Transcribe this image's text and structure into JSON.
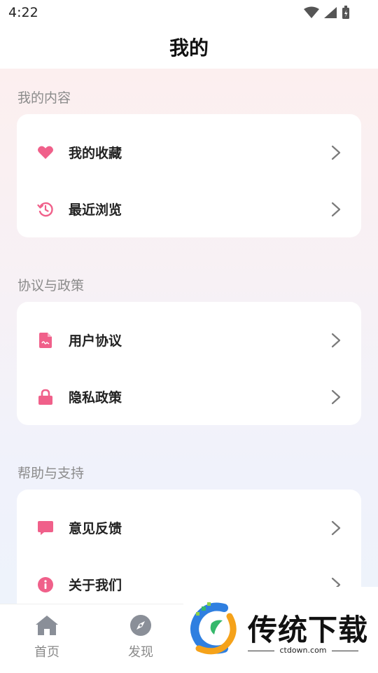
{
  "status": {
    "time": "4:22"
  },
  "header": {
    "title": "我的"
  },
  "sections": [
    {
      "title": "我的内容",
      "items": [
        {
          "label": "我的收藏",
          "icon": "heart-icon"
        },
        {
          "label": "最近浏览",
          "icon": "history-icon"
        }
      ]
    },
    {
      "title": "协议与政策",
      "items": [
        {
          "label": "用户协议",
          "icon": "document-icon"
        },
        {
          "label": "隐私政策",
          "icon": "lock-icon"
        }
      ]
    },
    {
      "title": "帮助与支持",
      "items": [
        {
          "label": "意见反馈",
          "icon": "feedback-icon"
        },
        {
          "label": "关于我们",
          "icon": "info-icon"
        }
      ]
    }
  ],
  "bottom_nav": {
    "items": [
      {
        "label": "首页",
        "icon": "home-icon"
      },
      {
        "label": "发现",
        "icon": "compass-icon"
      }
    ]
  },
  "watermark": {
    "text": "传统下载",
    "url": "ctdown.com"
  },
  "colors": {
    "accent": "#f0608a",
    "chevron": "#7a7a7a",
    "muted": "#8b8b8b"
  }
}
